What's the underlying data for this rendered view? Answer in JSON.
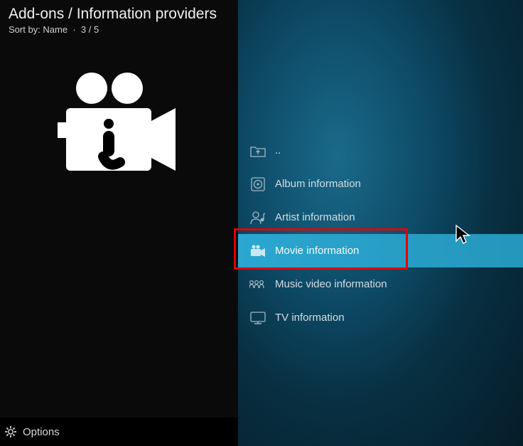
{
  "header": {
    "title": "Add-ons / Information providers",
    "sort_label": "Sort by: Name",
    "separator": "·",
    "position": "3 / 5"
  },
  "list": {
    "items": [
      {
        "label": "..",
        "icon": "folder-up"
      },
      {
        "label": "Album information",
        "icon": "album"
      },
      {
        "label": "Artist information",
        "icon": "artist"
      },
      {
        "label": "Movie information",
        "icon": "movie",
        "selected": true
      },
      {
        "label": "Music video information",
        "icon": "music-video"
      },
      {
        "label": "TV information",
        "icon": "tv"
      }
    ]
  },
  "footer": {
    "options_label": "Options"
  }
}
